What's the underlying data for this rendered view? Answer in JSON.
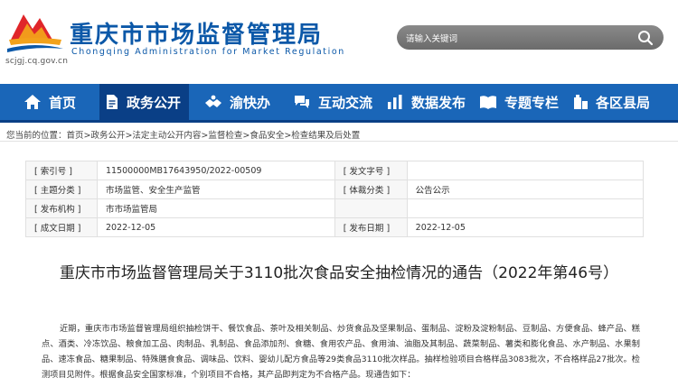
{
  "header": {
    "title": "重庆市市场监督管理局",
    "subtitle": "Chongqing Administration for Market Regulation",
    "domain": "scjgj.cq.gov.cn",
    "search_placeholder": "请输入关键词"
  },
  "nav": {
    "items": [
      {
        "label": "首页",
        "icon": "home-icon"
      },
      {
        "label": "政务公开",
        "icon": "document-icon",
        "active": true
      },
      {
        "label": "渝快办",
        "icon": "hands-icon"
      },
      {
        "label": "互动交流",
        "icon": "chat-icon"
      },
      {
        "label": "数据发布",
        "icon": "bar-chart-icon"
      },
      {
        "label": "专题专栏",
        "icon": "book-icon"
      },
      {
        "label": "各区县局",
        "icon": "building-icon"
      }
    ]
  },
  "breadcrumb": "您当前的位置：首页>政务公开>法定主动公开内容>监督检查>食品安全>检查结果及后处置",
  "meta": {
    "labels": {
      "index_no": "[ 索引号 ]",
      "doc_no": "[ 发文字号 ]",
      "theme": "[ 主题分类 ]",
      "genre": "[ 体裁分类 ]",
      "issuer": "[ 发布机构 ]",
      "created": "[ 成文日期 ]",
      "published": "[ 发布日期 ]"
    },
    "values": {
      "index_no": "11500000MB17643950/2022-00509",
      "doc_no": "",
      "theme": "市场监管、安全生产监管",
      "genre": "公告公示",
      "issuer": "市市场监管局",
      "created": "2022-12-05",
      "published": "2022-12-05"
    }
  },
  "article": {
    "title": "重庆市市场监督管理局关于3110批次食品安全抽检情况的通告（2022年第46号）",
    "paragraph": "近期，重庆市市场监督管理局组织抽检饼干、餐饮食品、茶叶及相关制品、炒货食品及坚果制品、蛋制品、淀粉及淀粉制品、豆制品、方便食品、蜂产品、糕点、酒类、冷冻饮品、粮食加工品、肉制品、乳制品、食品添加剂、食糖、食用农产品、食用油、油脂及其制品、蔬菜制品、薯类和膨化食品、水产制品、水果制品、速冻食品、糖果制品、特殊膳食食品、调味品、饮料、婴幼儿配方食品等29类食品3110批次样品。抽样检验项目合格样品3083批次，不合格样品27批次。检测项目见附件。根据食品安全国家标准，个别项目不合格，其产品即判定为不合格产品。现通告如下："
  },
  "colors": {
    "brand_blue": "#0b58a8",
    "nav_blue": "#1a66b8",
    "nav_active": "#0a3f86",
    "logo_red": "#e0262a",
    "logo_orange": "#f29a1b"
  }
}
